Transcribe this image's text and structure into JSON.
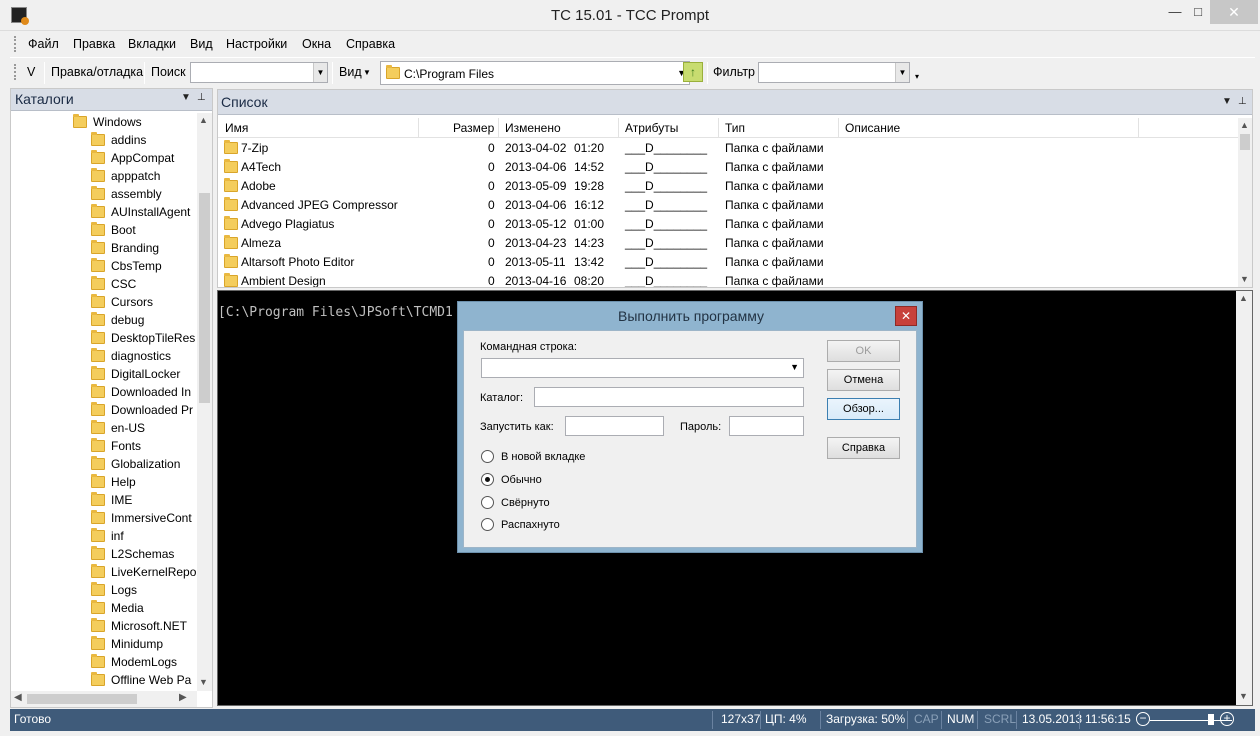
{
  "window": {
    "title": "TC 15.01 - TCC Prompt",
    "min": "—",
    "max": "□",
    "close": "✕"
  },
  "menu": [
    "Файл",
    "Правка",
    "Вкладки",
    "Вид",
    "Настройки",
    "Окна",
    "Справка"
  ],
  "toolbar": {
    "v_label": "V",
    "edit_debug": "Правка/отладка",
    "search_label": "Поиск",
    "search_value": "",
    "view_label": "Вид",
    "path": "C:\\Program Files",
    "filter_label": "Фильтр",
    "filter_value": ""
  },
  "tree": {
    "title": "Каталоги",
    "root": "Windows",
    "items": [
      "addins",
      "AppCompat",
      "apppatch",
      "assembly",
      "AUInstallAgent",
      "Boot",
      "Branding",
      "CbsTemp",
      "CSC",
      "Cursors",
      "debug",
      "DesktopTileRes",
      "diagnostics",
      "DigitalLocker",
      "Downloaded In",
      "Downloaded Pr",
      "en-US",
      "Fonts",
      "Globalization",
      "Help",
      "IME",
      "ImmersiveCont",
      "inf",
      "L2Schemas",
      "LiveKernelRepo",
      "Logs",
      "Media",
      "Microsoft.NET",
      "Minidump",
      "ModemLogs",
      "Offline Web Pa"
    ]
  },
  "list": {
    "title": "Список",
    "columns": [
      "Имя",
      "Размер",
      "Изменено",
      "Атрибуты",
      "Тип",
      "Описание"
    ],
    "rows": [
      {
        "name": "7-Zip",
        "size": "0",
        "date": "2013-04-02",
        "time": "01:20",
        "attr": "___D________",
        "type": "Папка с файлами"
      },
      {
        "name": "A4Tech",
        "size": "0",
        "date": "2013-04-06",
        "time": "14:52",
        "attr": "___D________",
        "type": "Папка с файлами"
      },
      {
        "name": "Adobe",
        "size": "0",
        "date": "2013-05-09",
        "time": "19:28",
        "attr": "___D________",
        "type": "Папка с файлами"
      },
      {
        "name": "Advanced JPEG Compressor",
        "size": "0",
        "date": "2013-04-06",
        "time": "16:12",
        "attr": "___D________",
        "type": "Папка с файлами"
      },
      {
        "name": "Advego Plagiatus",
        "size": "0",
        "date": "2013-05-12",
        "time": "01:00",
        "attr": "___D________",
        "type": "Папка с файлами"
      },
      {
        "name": "Almeza",
        "size": "0",
        "date": "2013-04-23",
        "time": "14:23",
        "attr": "___D________",
        "type": "Папка с файлами"
      },
      {
        "name": "Altarsoft Photo Editor",
        "size": "0",
        "date": "2013-05-11",
        "time": "13:42",
        "attr": "___D________",
        "type": "Папка с файлами"
      },
      {
        "name": "Ambient Design",
        "size": "0",
        "date": "2013-04-16",
        "time": "08:20",
        "attr": "___D________",
        "type": "Папка с файлами"
      }
    ]
  },
  "console": {
    "prompt": "[C:\\Program Files\\JPSoft\\TCMD1"
  },
  "dialog": {
    "title": "Выполнить программу",
    "cmd_label": "Командная строка:",
    "cmd_value": "",
    "dir_label": "Каталог:",
    "dir_value": "",
    "runas_label": "Запустить как:",
    "runas_value": "",
    "password_label": "Пароль:",
    "password_value": "",
    "radios": [
      "В новой вкладке",
      "Обычно",
      "Свёрнуто",
      "Распахнуто"
    ],
    "selected_radio": "Обычно",
    "ok": "OK",
    "cancel": "Отмена",
    "browse": "Обзор...",
    "help": "Справка"
  },
  "status": {
    "ready": "Готово",
    "size": "127x37",
    "cpu": "ЦП: 4%",
    "load": "Загрузка: 50%",
    "cap": "CAP",
    "num": "NUM",
    "scrl": "SCRL",
    "date": "13.05.2013",
    "time": "11:56:15"
  },
  "colors": {
    "statusbar": "#3f5b7a",
    "dialog_frame": "#8fb4cf",
    "console_bg": "#000000",
    "panel_header": "#d8dde6"
  }
}
